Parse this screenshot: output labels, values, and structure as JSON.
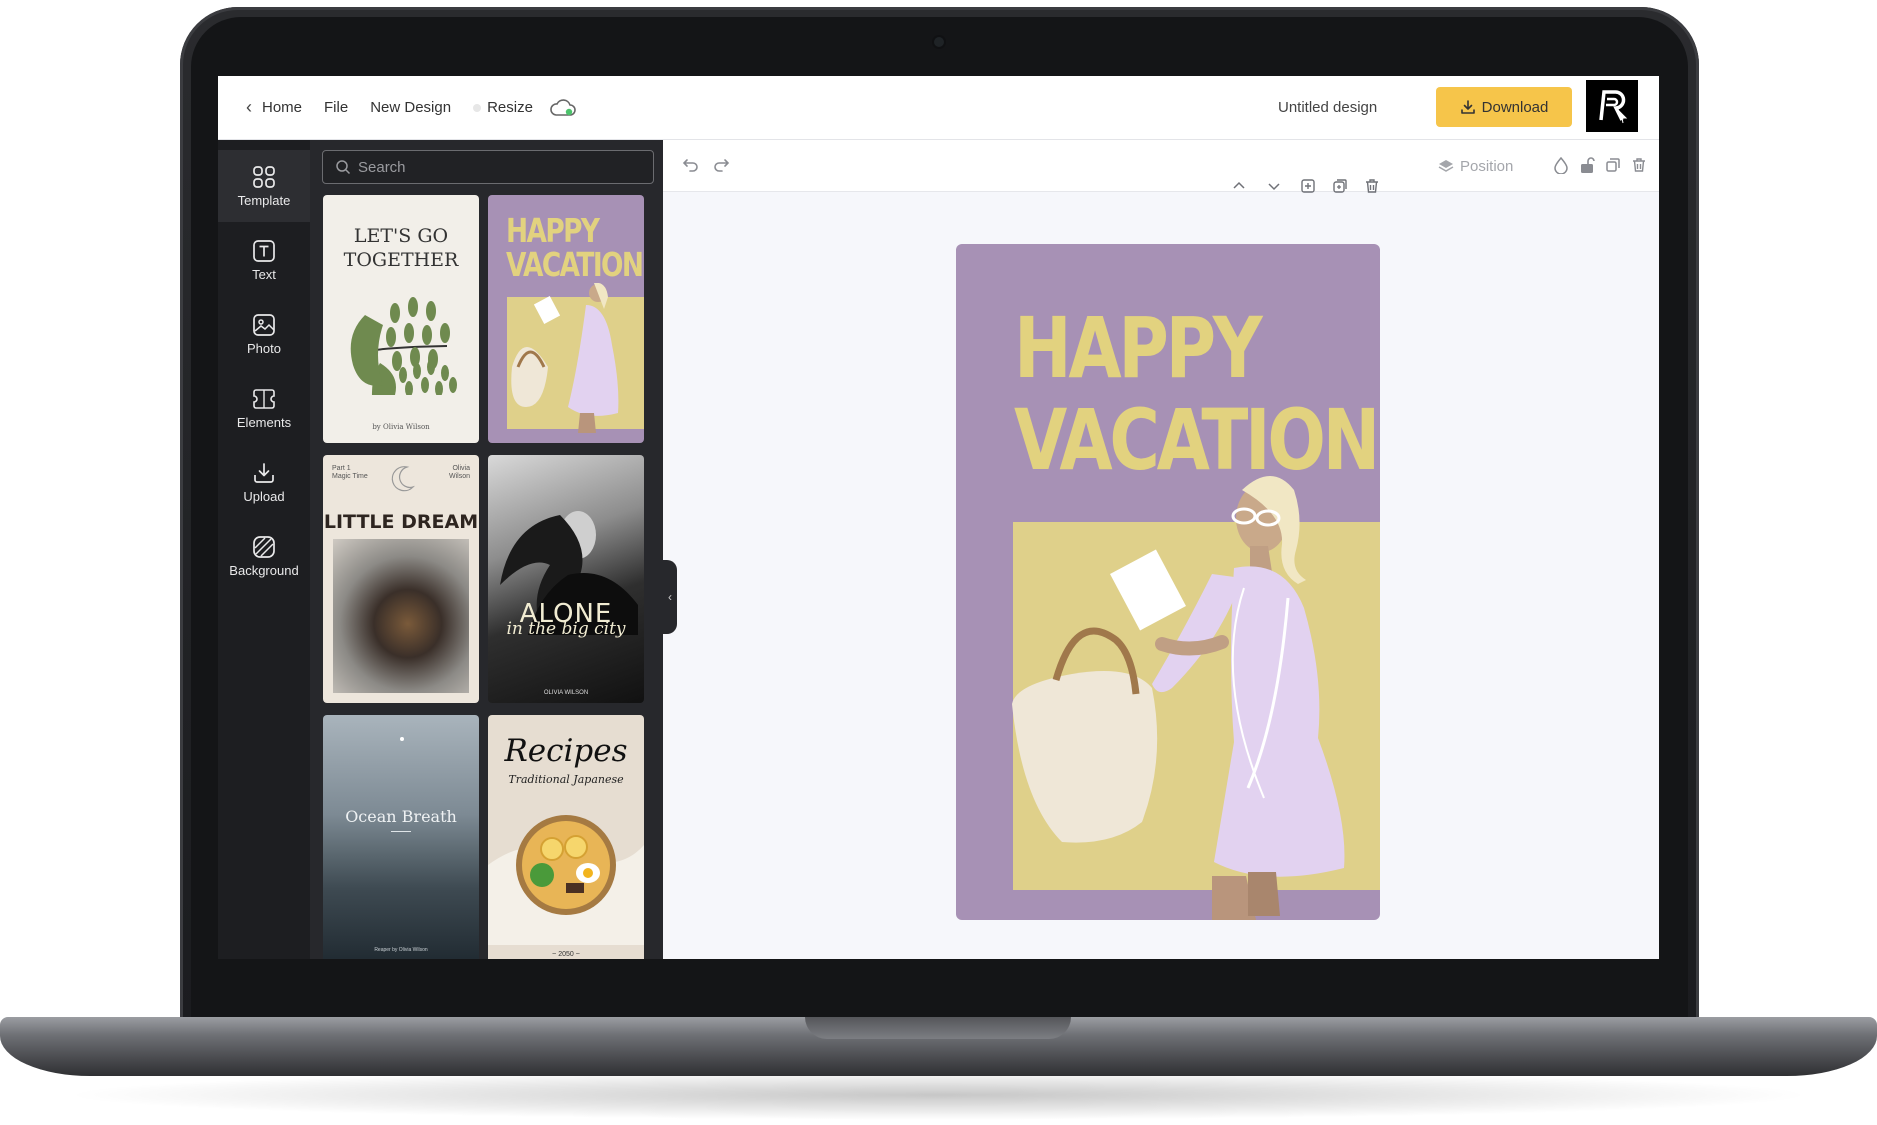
{
  "topbar": {
    "home": "Home",
    "file": "File",
    "new_design": "New Design",
    "resize": "Resize",
    "doc_title": "Untitled design",
    "download": "Download"
  },
  "rail": {
    "items": [
      {
        "label": "Template",
        "icon": "template-icon"
      },
      {
        "label": "Text",
        "icon": "text-icon"
      },
      {
        "label": "Photo",
        "icon": "photo-icon"
      },
      {
        "label": "Elements",
        "icon": "elements-icon"
      },
      {
        "label": "Upload",
        "icon": "upload-icon"
      },
      {
        "label": "Background",
        "icon": "background-icon"
      }
    ]
  },
  "panel": {
    "search_placeholder": "Search",
    "templates": [
      {
        "title_line1": "LET'S GO",
        "title_line2": "TOGETHER",
        "byline": "by Olivia Wilson"
      },
      {
        "title_line1": "HAPPY",
        "title_line2": "VACATION"
      },
      {
        "title": "LITTLE DREAM",
        "corner_left_1": "Part 1",
        "corner_left_2": "Magic Time",
        "corner_right_1": "Olivia",
        "corner_right_2": "Wilson"
      },
      {
        "title": "ALONE",
        "subtitle": "in the big city",
        "byline": "OLIVIA WILSON"
      },
      {
        "title": "Ocean Breath",
        "byline": "Reaper by Olivia Wilson"
      },
      {
        "title": "Recipes",
        "subtitle": "Traditional Japanese",
        "footer": "~ 2050 ~"
      }
    ]
  },
  "toolbar": {
    "position": "Position"
  },
  "design": {
    "title_line1": "HAPPY",
    "title_line2": "VACATION"
  },
  "colors": {
    "accent": "#f6c54a",
    "purple": "#a791b5",
    "yellow": "#dfd08a",
    "rail": "#1d1e21",
    "panel": "#27282c"
  }
}
